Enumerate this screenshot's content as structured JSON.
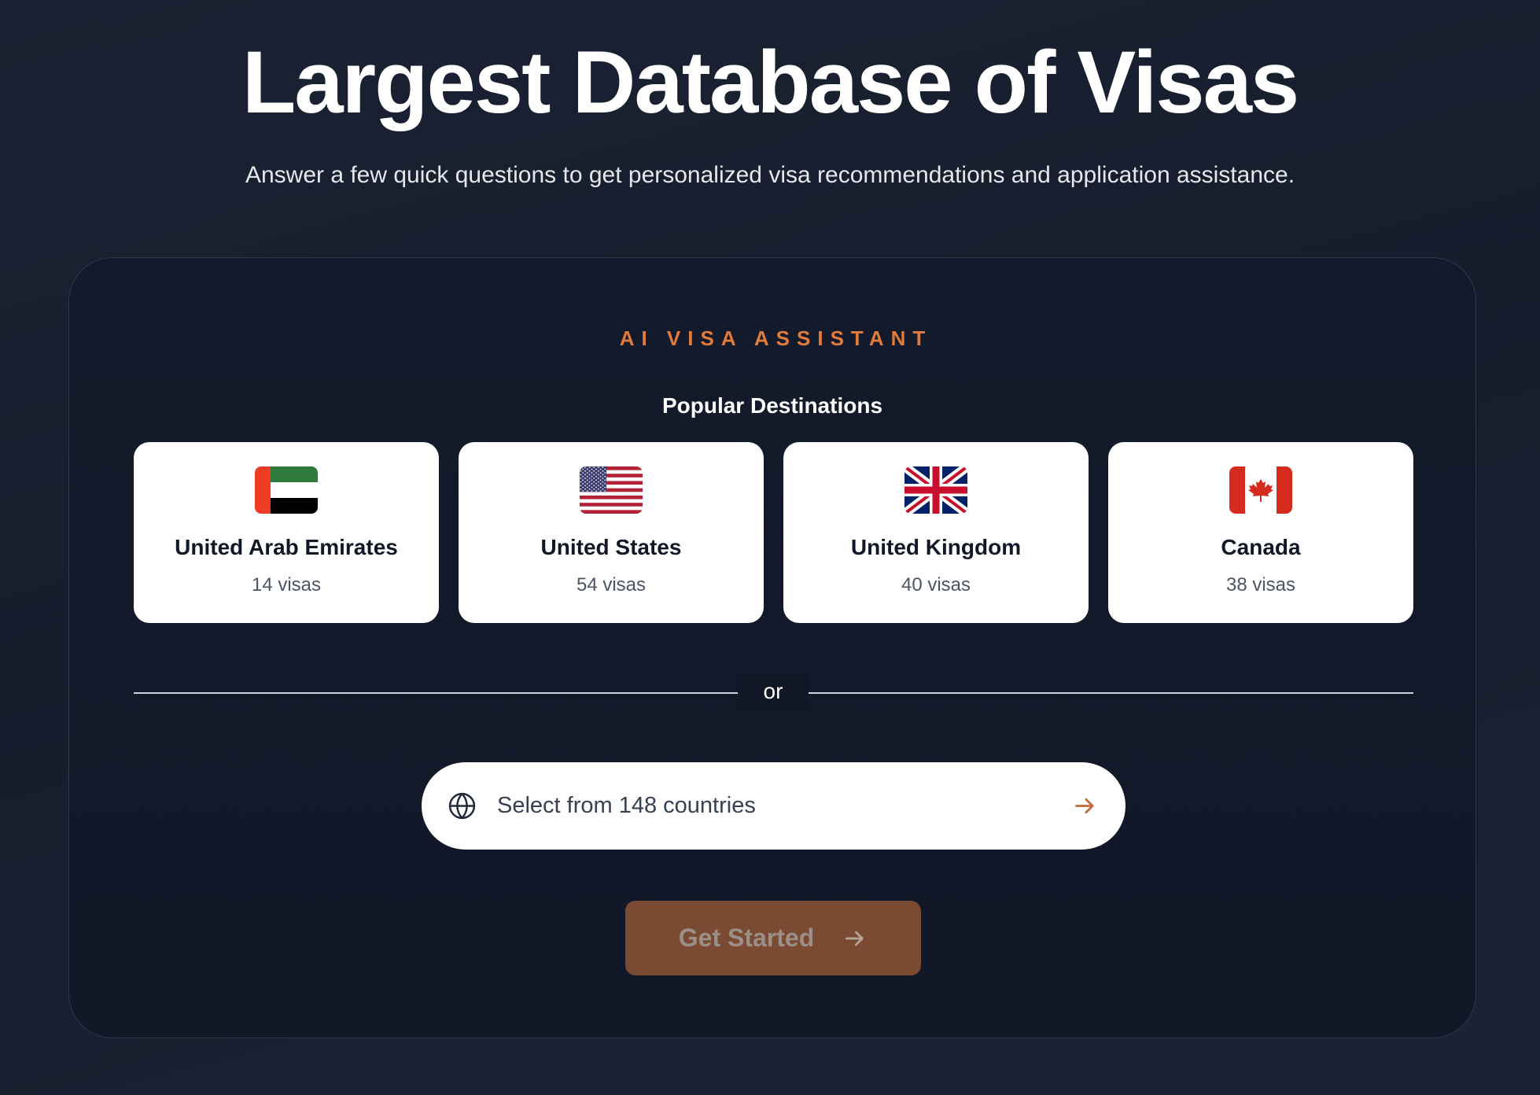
{
  "header": {
    "title": "Largest Database of Visas",
    "subtitle": "Answer a few quick questions to get personalized visa recommendations and application assistance."
  },
  "assistant": {
    "eyebrow": "AI VISA ASSISTANT",
    "popular_title": "Popular Destinations",
    "destinations": [
      {
        "name": "United Arab Emirates",
        "count": "14 visas",
        "flag_icon": "uae-flag-icon"
      },
      {
        "name": "United States",
        "count": "54 visas",
        "flag_icon": "us-flag-icon"
      },
      {
        "name": "United Kingdom",
        "count": "40 visas",
        "flag_icon": "uk-flag-icon"
      },
      {
        "name": "Canada",
        "count": "38 visas",
        "flag_icon": "canada-flag-icon"
      }
    ],
    "divider_label": "or",
    "country_select": {
      "label": "Select from 148 countries",
      "leading_icon": "globe-icon",
      "trailing_icon": "arrow-right-icon"
    },
    "cta": {
      "label": "Get Started",
      "icon": "arrow-right-icon"
    }
  },
  "colors": {
    "accent": "#e27a3c",
    "page_background": "#181f30",
    "card_background": "#131a2b",
    "cta_background": "#7b4a32",
    "cta_text": "#9c8f88"
  }
}
